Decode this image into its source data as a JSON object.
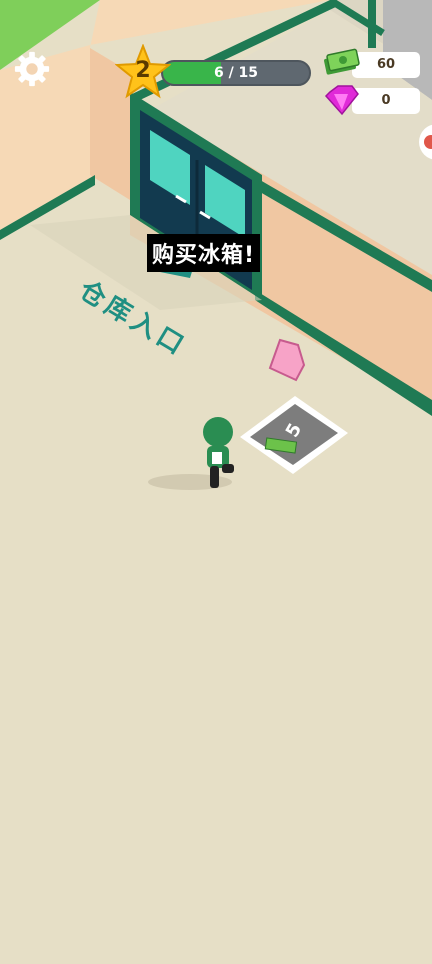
{
  "hud": {
    "level": "2",
    "xp_text": "6 / 15",
    "xp_progress": 0.4,
    "cash_value": "60",
    "gem_value": "0"
  },
  "world": {
    "popup_label": "购买冰箱!",
    "floor_label": "仓库入口",
    "pad_price": "5"
  },
  "icons": {
    "settings": "gear-icon",
    "level": "star-icon",
    "cash": "cash-icon",
    "gems": "gem-icon"
  },
  "colors": {
    "floor": "#e6dfc6",
    "wall": "#f0c7a2",
    "wall_trim": "#1f7a54",
    "door": "#123a4f",
    "xp_fill": "#39b54a",
    "accent_text": "#1f8f82"
  }
}
